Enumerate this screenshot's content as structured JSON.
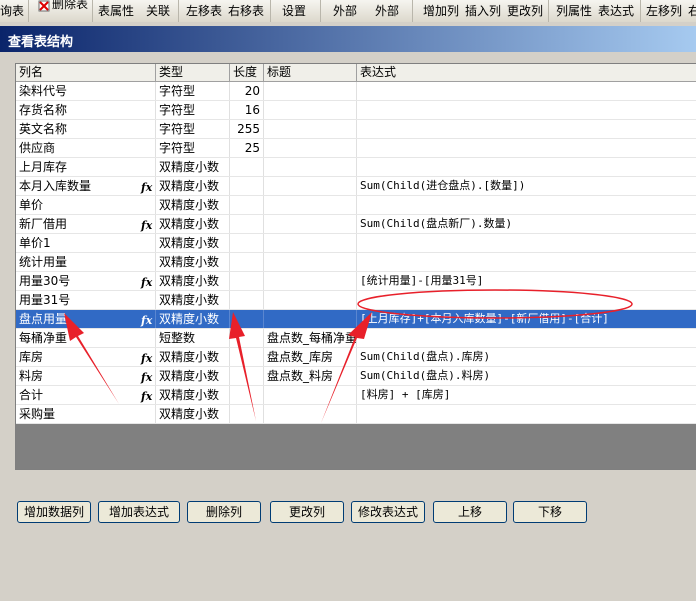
{
  "toolbar": {
    "items": [
      "询表",
      "删除表",
      "表属性",
      "关联",
      "左移表",
      "右移表",
      "设置",
      "外部",
      "外部",
      "增加列",
      "插入列",
      "更改列",
      "列属性",
      "表达式",
      "左移列",
      "右移"
    ]
  },
  "dialog": {
    "title": "查看表结构"
  },
  "columns": [
    "列名",
    "类型",
    "长度",
    "标题",
    "表达式"
  ],
  "rows": [
    {
      "name": "染料代号",
      "fx": "",
      "type": "字符型",
      "length": "20",
      "caption": "",
      "expr": ""
    },
    {
      "name": "存货名称",
      "fx": "",
      "type": "字符型",
      "length": "16",
      "caption": "",
      "expr": ""
    },
    {
      "name": "英文名称",
      "fx": "",
      "type": "字符型",
      "length": "255",
      "caption": "",
      "expr": ""
    },
    {
      "name": "供应商",
      "fx": "",
      "type": "字符型",
      "length": "25",
      "caption": "",
      "expr": ""
    },
    {
      "name": "上月库存",
      "fx": "",
      "type": "双精度小数",
      "length": "",
      "caption": "",
      "expr": ""
    },
    {
      "name": "本月入库数量",
      "fx": "fx",
      "type": "双精度小数",
      "length": "",
      "caption": "",
      "expr": "Sum(Child(进仓盘点).[数量])"
    },
    {
      "name": "单价",
      "fx": "",
      "type": "双精度小数",
      "length": "",
      "caption": "",
      "expr": ""
    },
    {
      "name": "新厂借用",
      "fx": "fx",
      "type": "双精度小数",
      "length": "",
      "caption": "",
      "expr": "Sum(Child(盘点新厂).数量)"
    },
    {
      "name": "单价1",
      "fx": "",
      "type": "双精度小数",
      "length": "",
      "caption": "",
      "expr": ""
    },
    {
      "name": "统计用量",
      "fx": "",
      "type": "双精度小数",
      "length": "",
      "caption": "",
      "expr": ""
    },
    {
      "name": "用量30号",
      "fx": "fx",
      "type": "双精度小数",
      "length": "",
      "caption": "",
      "expr": "[统计用量]-[用量31号]"
    },
    {
      "name": "用量31号",
      "fx": "",
      "type": "双精度小数",
      "length": "",
      "caption": "",
      "expr": ""
    },
    {
      "name": "盘点用量",
      "fx": "fx",
      "type": "双精度小数",
      "length": "",
      "caption": "",
      "expr": "[上月库存]+[本月入库数量]-[新厂借用]-[合计]"
    },
    {
      "name": "每桶净重",
      "fx": "",
      "type": "短整数",
      "length": "",
      "caption": "盘点数_每桶净重",
      "expr": ""
    },
    {
      "name": "库房",
      "fx": "fx",
      "type": "双精度小数",
      "length": "",
      "caption": "盘点数_库房",
      "expr": "Sum(Child(盘点).库房)"
    },
    {
      "name": "料房",
      "fx": "fx",
      "type": "双精度小数",
      "length": "",
      "caption": "盘点数_料房",
      "expr": "Sum(Child(盘点).料房)"
    },
    {
      "name": "合计",
      "fx": "fx",
      "type": "双精度小数",
      "length": "",
      "caption": "",
      "expr": "[料房] + [库房]"
    },
    {
      "name": "采购量",
      "fx": "",
      "type": "双精度小数",
      "length": "",
      "caption": "",
      "expr": ""
    }
  ],
  "selected_row": 12,
  "buttons": [
    "增加数据列",
    "增加表达式",
    "删除列",
    "更改列",
    "修改表达式",
    "上移",
    "下移"
  ],
  "colors": {
    "selection": "#316ac5",
    "title_bar_start": "#0a246a",
    "title_bar_end": "#a6caf0",
    "annotation_red": "#e8202a"
  }
}
